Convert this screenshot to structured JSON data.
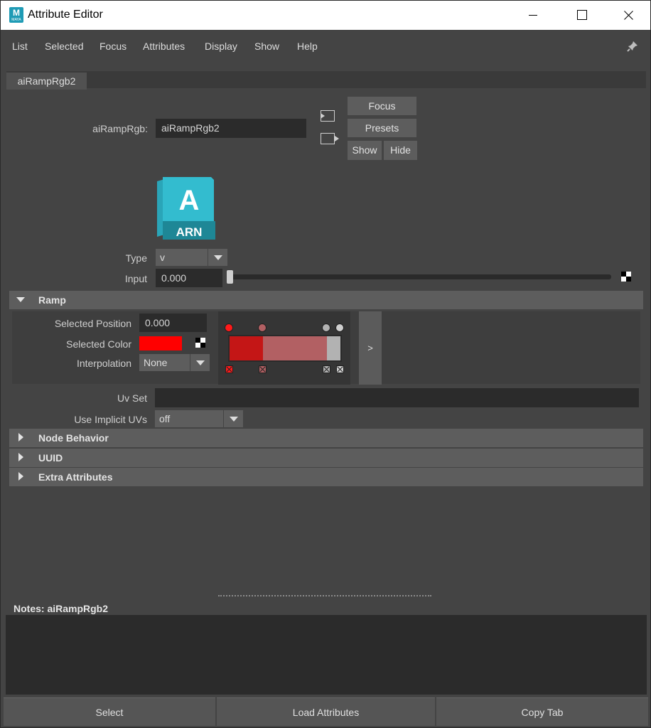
{
  "window": {
    "title": "Attribute Editor",
    "app_icon_letter": "M",
    "app_icon_sub": "MAYA"
  },
  "menu": [
    "List",
    "Selected",
    "Focus",
    "Attributes",
    "Display",
    "Show",
    "Help"
  ],
  "tab": {
    "label": "aiRampRgb2"
  },
  "node": {
    "type_label": "aiRampRgb:",
    "name": "aiRampRgb2",
    "buttons": {
      "focus": "Focus",
      "presets": "Presets",
      "show": "Show",
      "hide": "Hide"
    },
    "logo_letter": "A",
    "logo_text": "ARN"
  },
  "attrs": {
    "type_label": "Type",
    "type_value": "v",
    "input_label": "Input",
    "input_value": "0.000",
    "input_slider_fraction": 0.0
  },
  "ramp": {
    "title": "Ramp",
    "selected_position_label": "Selected Position",
    "selected_position_value": "0.000",
    "selected_color_label": "Selected Color",
    "selected_color": "#ff0000",
    "interpolation_label": "Interpolation",
    "interpolation_value": "None",
    "expand_label": ">",
    "stops": [
      {
        "position": 0.0,
        "color": "#c41616"
      },
      {
        "position": 0.3,
        "color": "#b26063"
      },
      {
        "position": 0.88,
        "color": "#b2b2b2"
      },
      {
        "position": 1.0,
        "color": "#cfcfcf"
      }
    ]
  },
  "uv": {
    "uvset_label": "Uv Set",
    "uvset_value": "",
    "implicit_label": "Use Implicit UVs",
    "implicit_value": "off"
  },
  "sections": [
    "Node Behavior",
    "UUID",
    "Extra Attributes"
  ],
  "notes": {
    "label": "Notes:  aiRampRgb2",
    "value": ""
  },
  "footer": {
    "select": "Select",
    "load": "Load Attributes",
    "copy": "Copy Tab"
  }
}
